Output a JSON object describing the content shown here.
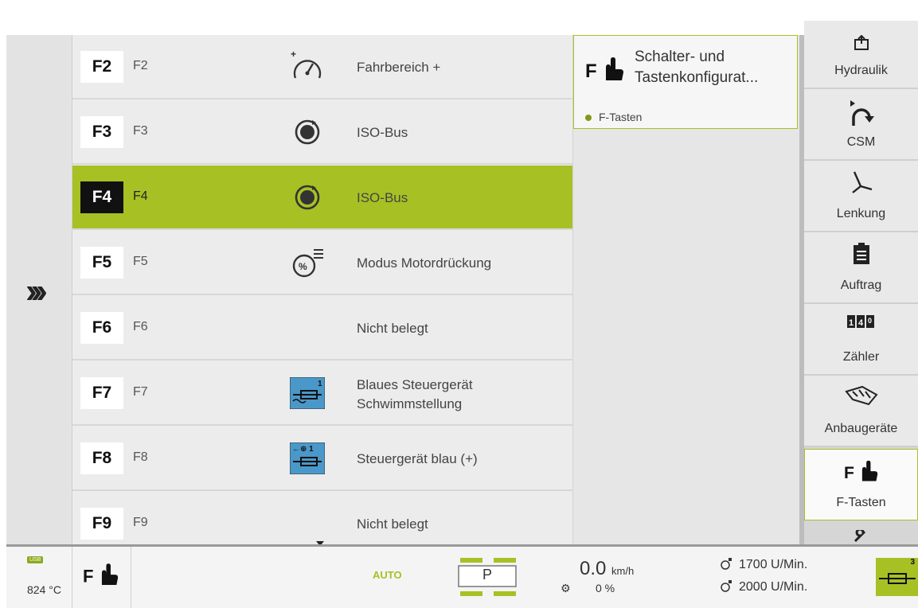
{
  "list": {
    "rows": [
      {
        "key": "F2",
        "label": "F2",
        "icon": "gear-range-up-icon",
        "desc": "Fahrbereich +"
      },
      {
        "key": "F3",
        "label": "F3",
        "icon": "isobus-icon",
        "desc": "ISO-Bus"
      },
      {
        "key": "F4",
        "label": "F4",
        "icon": "isobus-icon",
        "desc": "ISO-Bus",
        "selected": true
      },
      {
        "key": "F5",
        "label": "F5",
        "icon": "engine-droop-mode-icon",
        "desc": "Modus Motordrückung"
      },
      {
        "key": "F6",
        "label": "F6",
        "icon": "",
        "desc": "Nicht belegt"
      },
      {
        "key": "F7",
        "label": "F7",
        "icon": "blue-valve-float-icon",
        "desc": "Blaues Steuergerät",
        "desc2": "Schwimmstellung"
      },
      {
        "key": "F8",
        "label": "F8",
        "icon": "blue-valve-plus-icon",
        "desc": "Steuergerät blau (+)"
      },
      {
        "key": "F9",
        "label": "F9",
        "icon": "",
        "desc": "Nicht belegt"
      }
    ]
  },
  "info": {
    "title_line1": "Schalter- und",
    "title_line2": "Tastenkonfigurat...",
    "status": "F-Tasten",
    "icon": "f-hand-icon"
  },
  "sidebar": {
    "items": [
      {
        "label": "Hydraulik",
        "icon": "hydraulic-icon"
      },
      {
        "label": "CSM",
        "icon": "csm-icon"
      },
      {
        "label": "Lenkung",
        "icon": "steering-icon"
      },
      {
        "label": "Auftrag",
        "icon": "clipboard-icon"
      },
      {
        "label": "Zähler",
        "icon": "counter-icon"
      },
      {
        "label": "Anbaugeräte",
        "icon": "implement-icon"
      },
      {
        "label": "F-Tasten",
        "icon": "f-hand-icon",
        "active": true
      }
    ]
  },
  "statusbar": {
    "usb": "USB",
    "temp": "824 °C",
    "auto": "AUTO",
    "gear": "P",
    "speed": "0.0",
    "speed_unit": "km/h",
    "slip": "0 %",
    "rpm1": "1700 U/Min.",
    "rpm2": "2000 U/Min.",
    "hyd_badge": "3"
  },
  "colors": {
    "accent": "#a7c124",
    "valve_blue": "#4a98c9"
  }
}
